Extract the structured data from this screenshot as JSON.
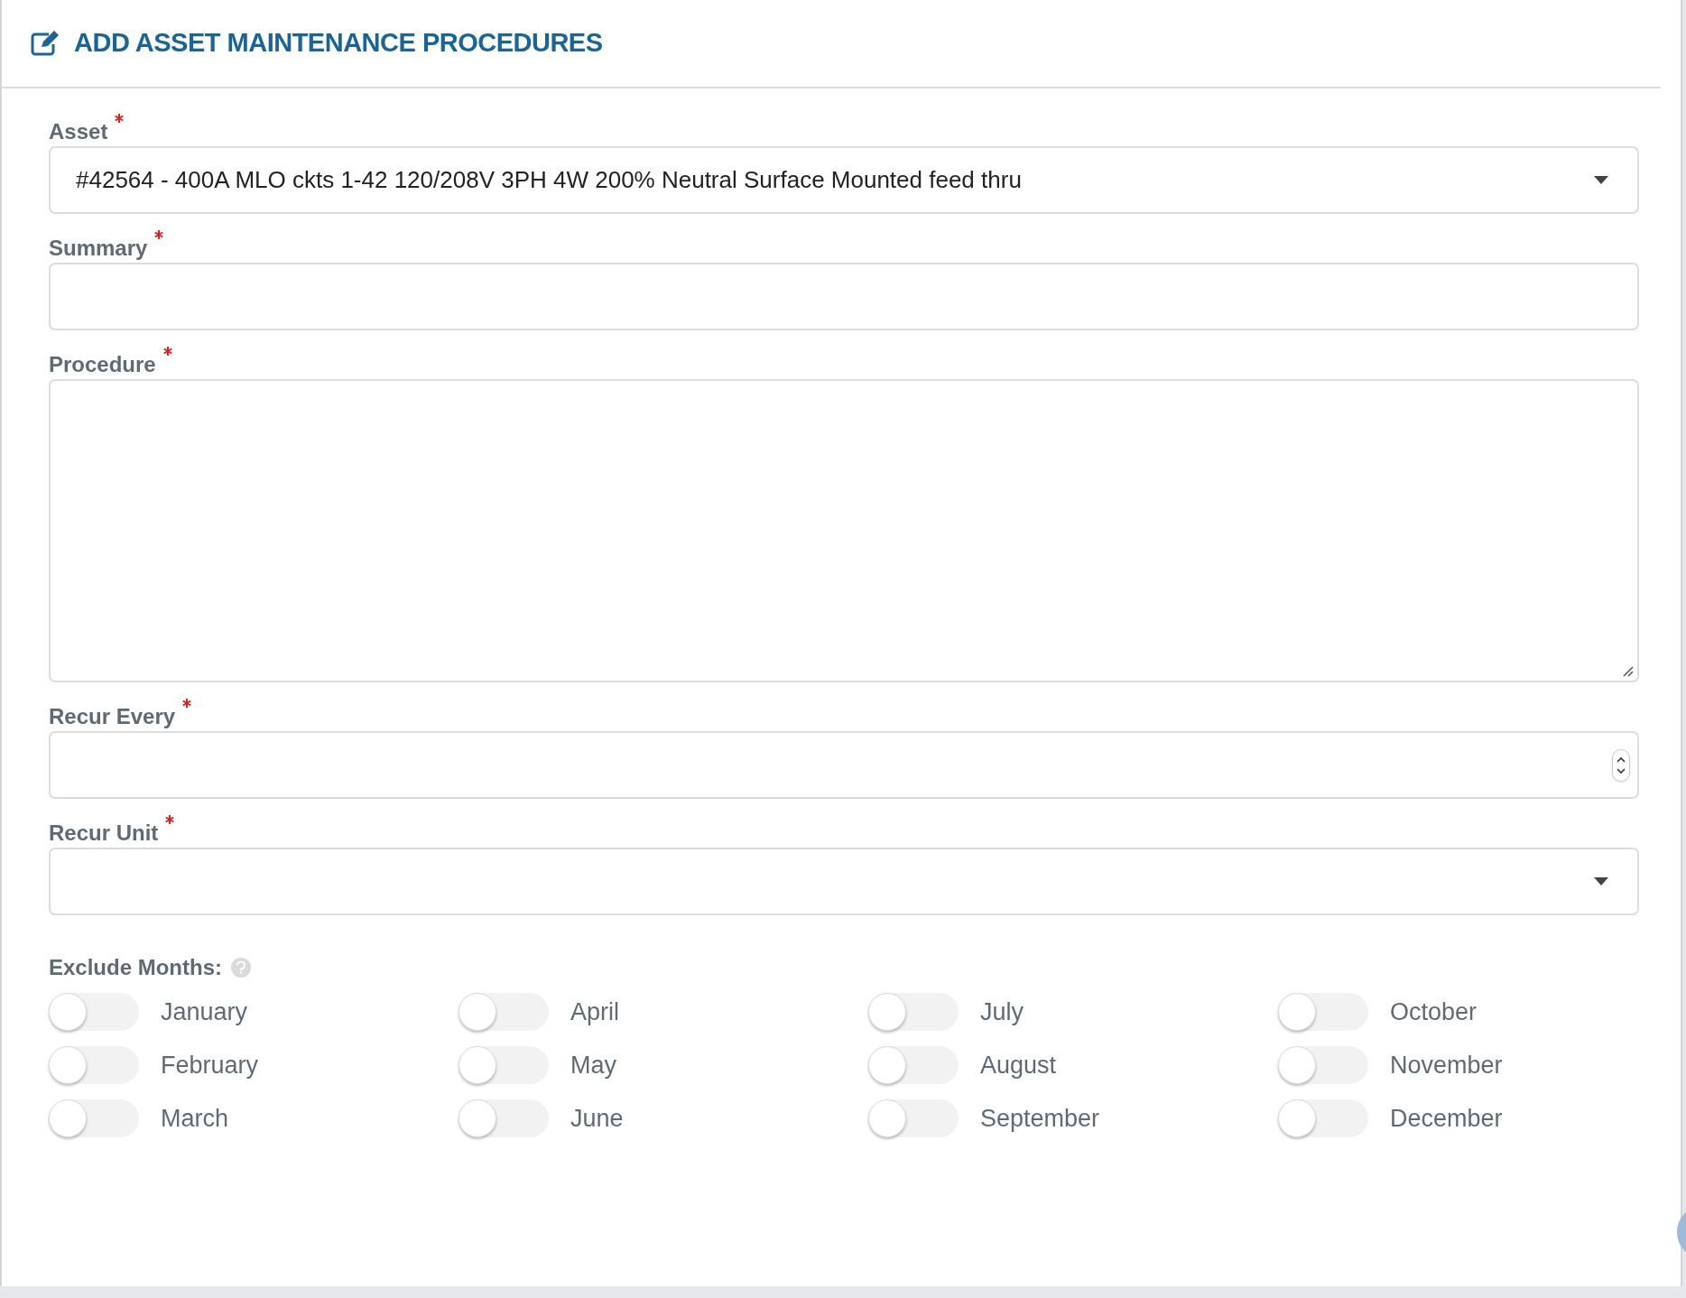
{
  "title": "ADD ASSET MAINTENANCE PROCEDURES",
  "fields": [
    {
      "kind": "select",
      "label": "Asset",
      "required": true,
      "value": "#42564 - 400A MLO ckts 1-42 120/208V 3PH 4W 200% Neutral Surface Mounted feed thru"
    },
    {
      "kind": "text",
      "label": "Summary",
      "required": true
    },
    {
      "kind": "textarea",
      "label": "Procedure",
      "required": true
    },
    {
      "kind": "number",
      "label": "Recur Every",
      "required": true
    },
    {
      "kind": "select",
      "label": "Recur Unit",
      "required": true
    }
  ],
  "exclude_months": {
    "label": "Exclude Months:",
    "months": [
      {
        "label": "January",
        "on": false
      },
      {
        "label": "February",
        "on": false
      },
      {
        "label": "March",
        "on": false
      },
      {
        "label": "April",
        "on": false
      },
      {
        "label": "May",
        "on": false
      },
      {
        "label": "June",
        "on": false
      },
      {
        "label": "July",
        "on": false
      },
      {
        "label": "August",
        "on": false
      },
      {
        "label": "September",
        "on": false
      },
      {
        "label": "October",
        "on": false
      },
      {
        "label": "November",
        "on": false
      },
      {
        "label": "December",
        "on": false
      }
    ]
  }
}
